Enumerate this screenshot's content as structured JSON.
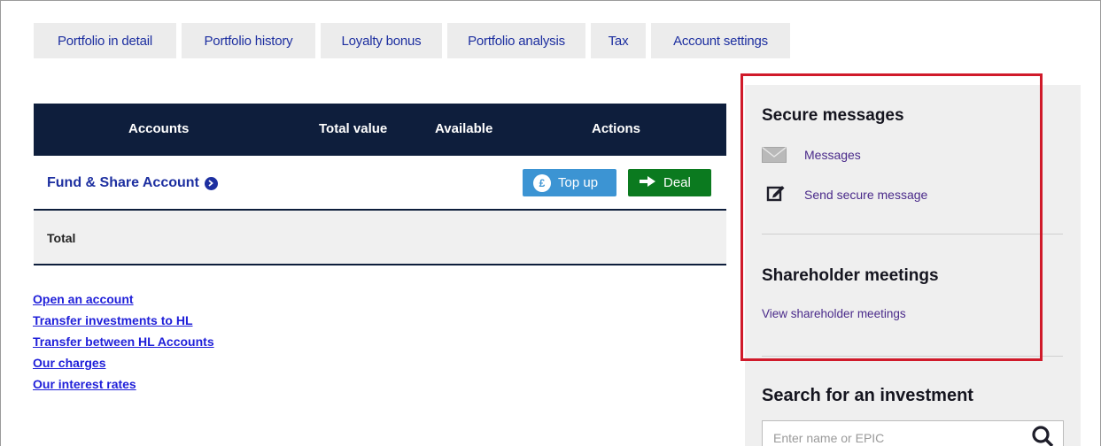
{
  "tabs": [
    {
      "label": "Portfolio in detail"
    },
    {
      "label": "Portfolio history"
    },
    {
      "label": "Loyalty bonus"
    },
    {
      "label": "Portfolio analysis"
    },
    {
      "label": "Tax"
    },
    {
      "label": "Account settings"
    }
  ],
  "accounts_table": {
    "headers": {
      "accounts": "Accounts",
      "total_value": "Total value",
      "available": "Available",
      "actions": "Actions"
    },
    "rows": [
      {
        "name": "Fund & Share Account",
        "topup_label": "Top up",
        "deal_label": "Deal"
      }
    ],
    "total_label": "Total"
  },
  "links": [
    {
      "label": "Open an account"
    },
    {
      "label": "Transfer investments to HL"
    },
    {
      "label": "Transfer between HL Accounts"
    },
    {
      "label": "Our charges"
    },
    {
      "label": "Our interest rates"
    }
  ],
  "sidebar": {
    "secure_messages": {
      "title": "Secure messages",
      "messages_label": "Messages",
      "send_label": "Send secure message"
    },
    "shareholder_meetings": {
      "title": "Shareholder meetings",
      "view_label": "View shareholder meetings"
    },
    "search": {
      "title": "Search for an investment",
      "placeholder": "Enter name or EPIC"
    }
  },
  "icons": {
    "envelope": "envelope-icon",
    "compose": "compose-icon",
    "search": "search-icon",
    "chevron": "chevron-right-icon",
    "pound": "pound-icon",
    "arrow": "arrow-right-icon"
  },
  "colors": {
    "navy": "#0e1e3c",
    "link_blue": "#1d2fa0",
    "topup_blue": "#3c94d3",
    "deal_green": "#0b7a1f",
    "highlight_red": "#d01a2a",
    "panel_grey": "#efefef"
  }
}
